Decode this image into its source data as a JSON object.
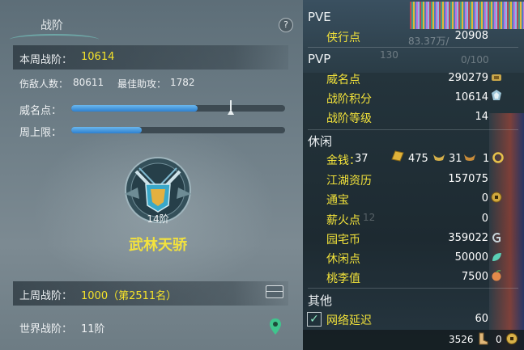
{
  "left": {
    "title": "战阶",
    "help_label": "?",
    "week_rank_label": "本周战阶：",
    "week_rank_value": "10614",
    "kills_label": "伤敌人数：",
    "kills_value": "80611",
    "assist_label": "最佳助攻：",
    "assist_value": "1782",
    "prestige_label": "威名点：",
    "prestige_progress": 0.59,
    "week_limit_label": "周上限：",
    "week_limit_progress": 0.33,
    "rank_level": "14阶",
    "rank_title": "武林天骄",
    "last_week_label": "上周战阶：",
    "last_week_value": "1000（第2511名）",
    "world_rank_label": "世界战阶：",
    "world_rank_value": "11阶"
  },
  "right": {
    "pve": {
      "header": "PVE",
      "items": [
        {
          "label": "侠行点",
          "value": "20908"
        }
      ]
    },
    "pvp": {
      "header": "PVP",
      "items": [
        {
          "label": "威名点",
          "value": "290279"
        },
        {
          "label": "战阶积分",
          "value": "10614"
        },
        {
          "label": "战阶等级",
          "value": "14"
        }
      ]
    },
    "leisure": {
      "header": "休闲",
      "money_label": "金钱：",
      "money_gold": "37",
      "money_silver": "475",
      "money_copper": "31",
      "money_other": "1",
      "items": [
        {
          "label": "江湖资历",
          "value": "157075"
        },
        {
          "label": "通宝",
          "value": "0"
        },
        {
          "label": "薪火点",
          "value": "0"
        },
        {
          "label": "园宅币",
          "value": "359022"
        },
        {
          "label": "休闲点",
          "value": "50000"
        },
        {
          "label": "桃李值",
          "value": "7500"
        }
      ]
    },
    "other": {
      "header": "其他",
      "items": [
        {
          "label": "网络延迟",
          "value": "60"
        }
      ]
    },
    "footer": {
      "value_a": "3526",
      "value_b": "0"
    },
    "bg_text": {
      "hp_text": "83.37万/",
      "num_130": "130",
      "progress_text": "0/100",
      "num_12": "12"
    }
  },
  "colors": {
    "gold_text": "#f5e22a",
    "bar_blue": "#3f93dd",
    "panel_dark": "#1e2c33"
  }
}
